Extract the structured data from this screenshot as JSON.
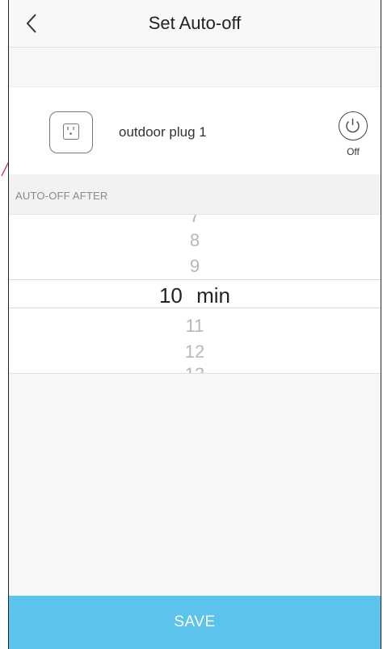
{
  "header": {
    "title": "Set Auto-off",
    "back_icon": "chevron-left-icon"
  },
  "device": {
    "name": "outdoor plug 1",
    "icon": "outlet-icon",
    "power_icon": "power-icon",
    "power_state": "Off"
  },
  "section": {
    "label": "AUTO-OFF AFTER"
  },
  "picker": {
    "above": [
      "7",
      "8",
      "9"
    ],
    "selected": "10",
    "unit": "min",
    "below": [
      "11",
      "12",
      "13"
    ]
  },
  "footer": {
    "save_label": "SAVE",
    "save_color": "#5bc3ec"
  }
}
